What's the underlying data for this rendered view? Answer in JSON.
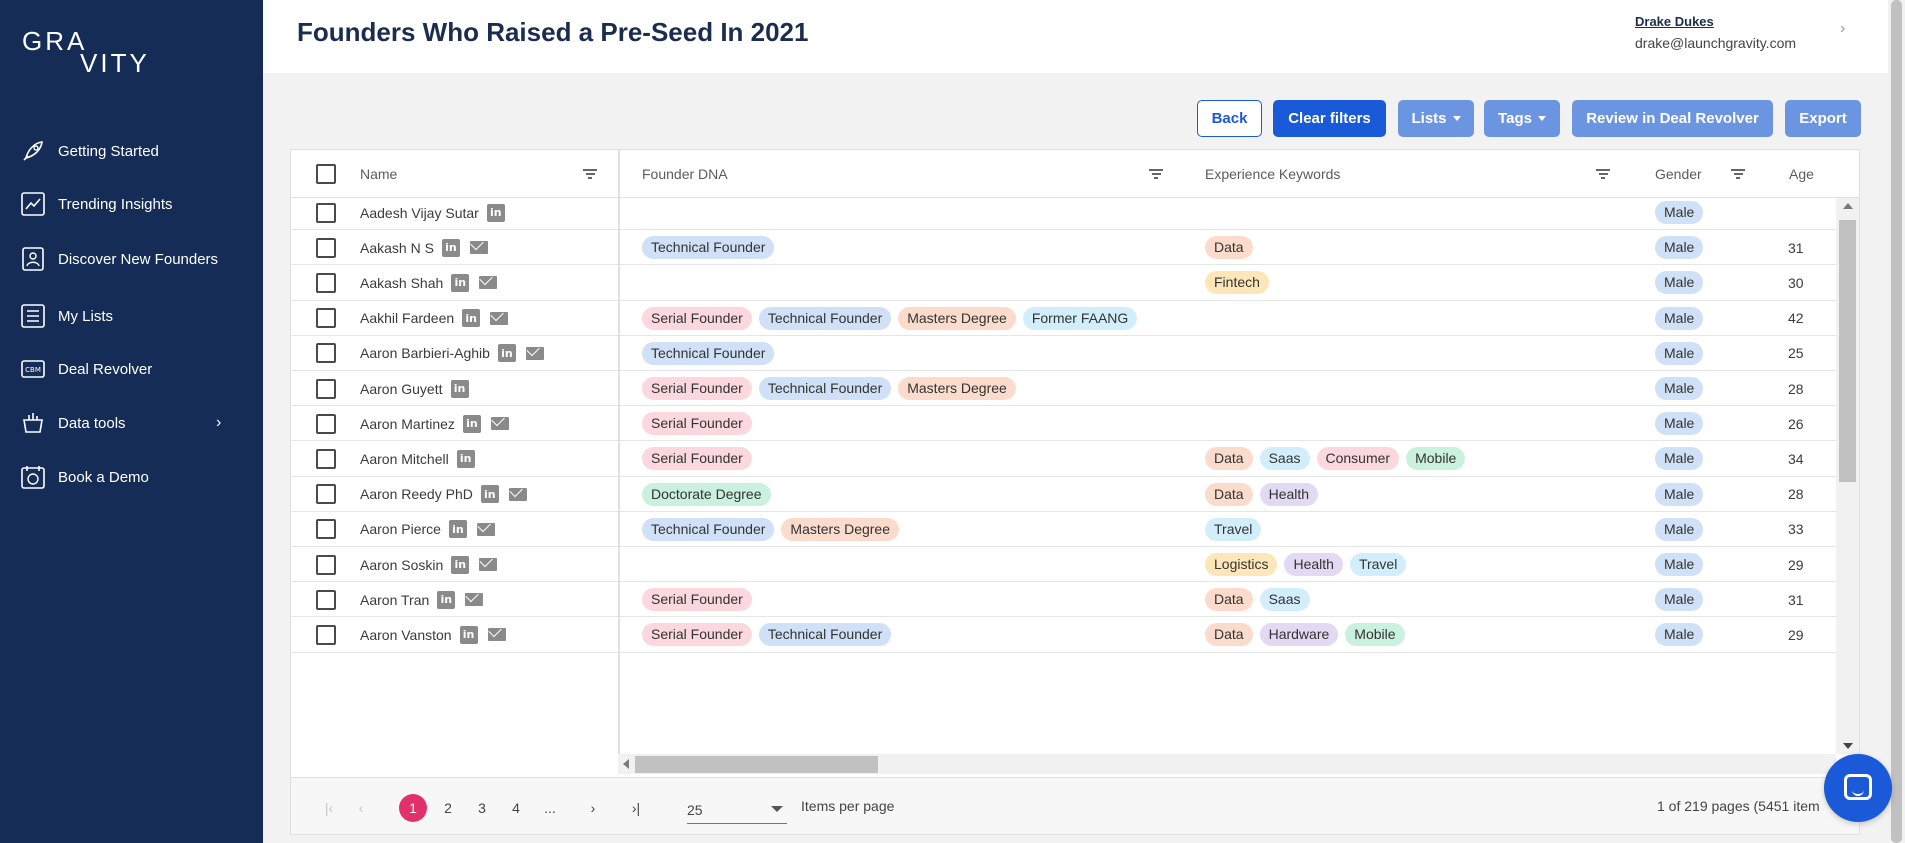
{
  "brand": {
    "line1": "GRA",
    "line2": "VITY"
  },
  "sidebar": {
    "items": [
      {
        "label": "Getting Started",
        "icon": "rocket-icon"
      },
      {
        "label": "Trending Insights",
        "icon": "trend-chart-icon"
      },
      {
        "label": "Discover New Founders",
        "icon": "founder-card-icon"
      },
      {
        "label": "My Lists",
        "icon": "list-icon"
      },
      {
        "label": "Deal Revolver",
        "icon": "deal-revolver-icon"
      },
      {
        "label": "Data tools",
        "icon": "data-tools-icon",
        "chevron": "›"
      },
      {
        "label": "Book a Demo",
        "icon": "calendar-icon"
      }
    ]
  },
  "header": {
    "title": "Founders Who Raised a Pre-Seed In 2021",
    "user_name": "Drake Dukes",
    "user_email": "drake@launchgravity.com",
    "chevron": "›"
  },
  "toolbar": {
    "back": "Back",
    "clear_filters": "Clear filters",
    "lists": "Lists",
    "tags": "Tags",
    "review": "Review in Deal Revolver",
    "export": "Export"
  },
  "table": {
    "columns": {
      "name": "Name",
      "dna": "Founder DNA",
      "keywords": "Experience Keywords",
      "gender": "Gender",
      "age": "Age"
    },
    "rows": [
      {
        "name": "Aadesh Vijay Sutar",
        "linkedin": true,
        "email": false,
        "dna": [],
        "keywords": [],
        "gender": "Male",
        "age": ""
      },
      {
        "name": "Aakash N S",
        "linkedin": true,
        "email": true,
        "dna": [
          "Technical Founder"
        ],
        "keywords": [
          "Data"
        ],
        "gender": "Male",
        "age": "31"
      },
      {
        "name": "Aakash Shah",
        "linkedin": true,
        "email": true,
        "dna": [],
        "keywords": [
          "Fintech"
        ],
        "gender": "Male",
        "age": "30"
      },
      {
        "name": "Aakhil Fardeen",
        "linkedin": true,
        "email": true,
        "dna": [
          "Serial Founder",
          "Technical Founder",
          "Masters Degree",
          "Former FAANG"
        ],
        "keywords": [],
        "gender": "Male",
        "age": "42"
      },
      {
        "name": "Aaron Barbieri-Aghib",
        "linkedin": true,
        "email": true,
        "dna": [
          "Technical Founder"
        ],
        "keywords": [],
        "gender": "Male",
        "age": "25"
      },
      {
        "name": "Aaron Guyett",
        "linkedin": true,
        "email": false,
        "dna": [
          "Serial Founder",
          "Technical Founder",
          "Masters Degree"
        ],
        "keywords": [],
        "gender": "Male",
        "age": "28"
      },
      {
        "name": "Aaron Martinez",
        "linkedin": true,
        "email": true,
        "dna": [
          "Serial Founder"
        ],
        "keywords": [],
        "gender": "Male",
        "age": "26"
      },
      {
        "name": "Aaron Mitchell",
        "linkedin": true,
        "email": false,
        "dna": [
          "Serial Founder"
        ],
        "keywords": [
          "Data",
          "Saas",
          "Consumer",
          "Mobile"
        ],
        "gender": "Male",
        "age": "34"
      },
      {
        "name": "Aaron Reedy PhD",
        "linkedin": true,
        "email": true,
        "dna": [
          "Doctorate Degree"
        ],
        "keywords": [
          "Data",
          "Health"
        ],
        "gender": "Male",
        "age": "28"
      },
      {
        "name": "Aaron Pierce",
        "linkedin": true,
        "email": true,
        "dna": [
          "Technical Founder",
          "Masters Degree"
        ],
        "keywords": [
          "Travel"
        ],
        "gender": "Male",
        "age": "33"
      },
      {
        "name": "Aaron Soskin",
        "linkedin": true,
        "email": true,
        "dna": [],
        "keywords": [
          "Logistics",
          "Health",
          "Travel"
        ],
        "gender": "Male",
        "age": "29"
      },
      {
        "name": "Aaron Tran",
        "linkedin": true,
        "email": true,
        "dna": [
          "Serial Founder"
        ],
        "keywords": [
          "Data",
          "Saas"
        ],
        "gender": "Male",
        "age": "31"
      },
      {
        "name": "Aaron Vanston",
        "linkedin": true,
        "email": true,
        "dna": [
          "Serial Founder",
          "Technical Founder"
        ],
        "keywords": [
          "Data",
          "Hardware",
          "Mobile"
        ],
        "gender": "Male",
        "age": "29"
      }
    ]
  },
  "pager": {
    "first": "|‹",
    "prev": "‹",
    "pages": [
      "1",
      "2",
      "3",
      "4",
      "..."
    ],
    "active_page": "1",
    "next": "›",
    "last": "›|",
    "per_page": "25",
    "per_page_label": "Items per page",
    "info": "1 of 219 pages (5451 item"
  },
  "icons": {
    "linkedin": "in"
  },
  "colors": {
    "sidebar_bg": "#142c56",
    "primary": "#1a5ad8",
    "secondary_btn": "#6b95e1",
    "active_page": "#e1306c"
  }
}
